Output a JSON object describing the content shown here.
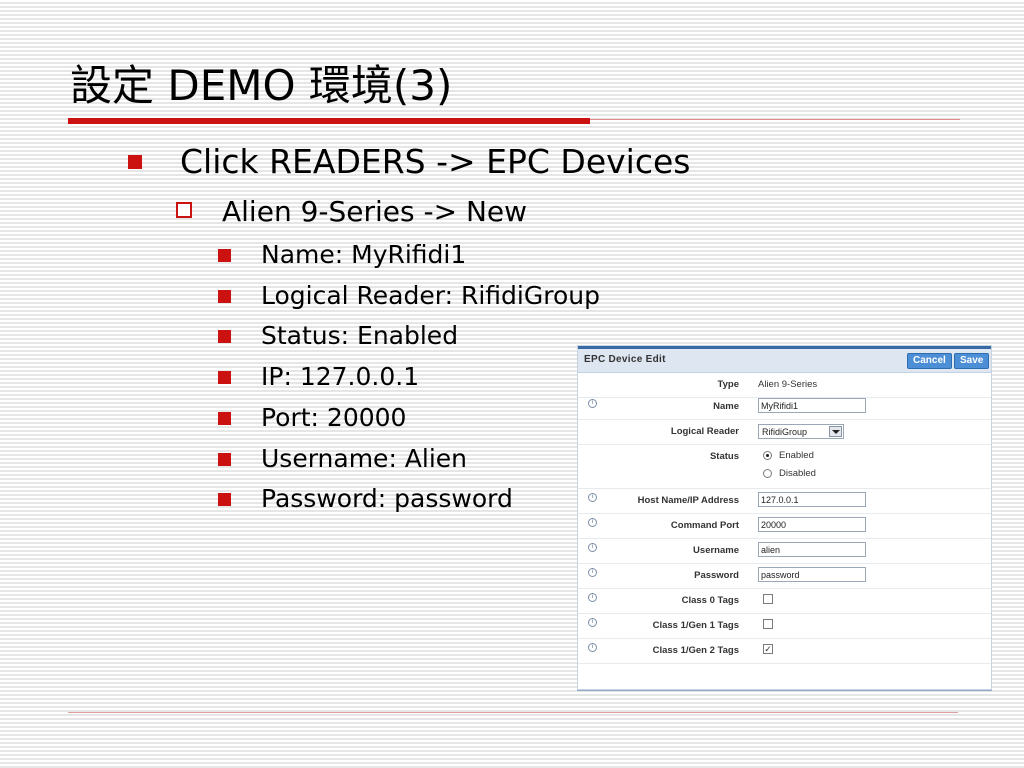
{
  "slide": {
    "title": "設定 DEMO 環境(3)",
    "bullet_level1": "Click READERS -> EPC Devices",
    "bullet_level2": "Alien 9-Series -> New",
    "bullets_level3": [
      "Name: MyRifidi1",
      "Logical Reader: RifidiGroup",
      "Status: Enabled",
      "IP: 127.0.0.1",
      "Port: 20000",
      "Username: Alien",
      "Password: password"
    ],
    "colors": {
      "accent": "#cc1111",
      "panel_header": "#dde6f1",
      "button": "#4c8fd6"
    }
  },
  "panel": {
    "title": "EPC Device Edit",
    "cancel_label": "Cancel",
    "save_label": "Save",
    "info_icon": "info-icon",
    "fields": {
      "type": {
        "label": "Type",
        "value": "Alien 9-Series"
      },
      "name": {
        "label": "Name",
        "value": "MyRifidi1"
      },
      "logical_reader": {
        "label": "Logical Reader",
        "value": "RifidiGroup"
      },
      "status": {
        "label": "Status",
        "options": [
          "Enabled",
          "Disabled"
        ],
        "selected": "Enabled"
      },
      "host": {
        "label": "Host Name/IP Address",
        "value": "127.0.0.1"
      },
      "command_port": {
        "label": "Command Port",
        "value": "20000"
      },
      "username": {
        "label": "Username",
        "value": "alien"
      },
      "password": {
        "label": "Password",
        "value": "password"
      },
      "class0": {
        "label": "Class 0 Tags",
        "checked": false
      },
      "class1gen1": {
        "label": "Class 1/Gen 1 Tags",
        "checked": false
      },
      "class1gen2": {
        "label": "Class 1/Gen 2 Tags",
        "checked": true
      }
    }
  }
}
